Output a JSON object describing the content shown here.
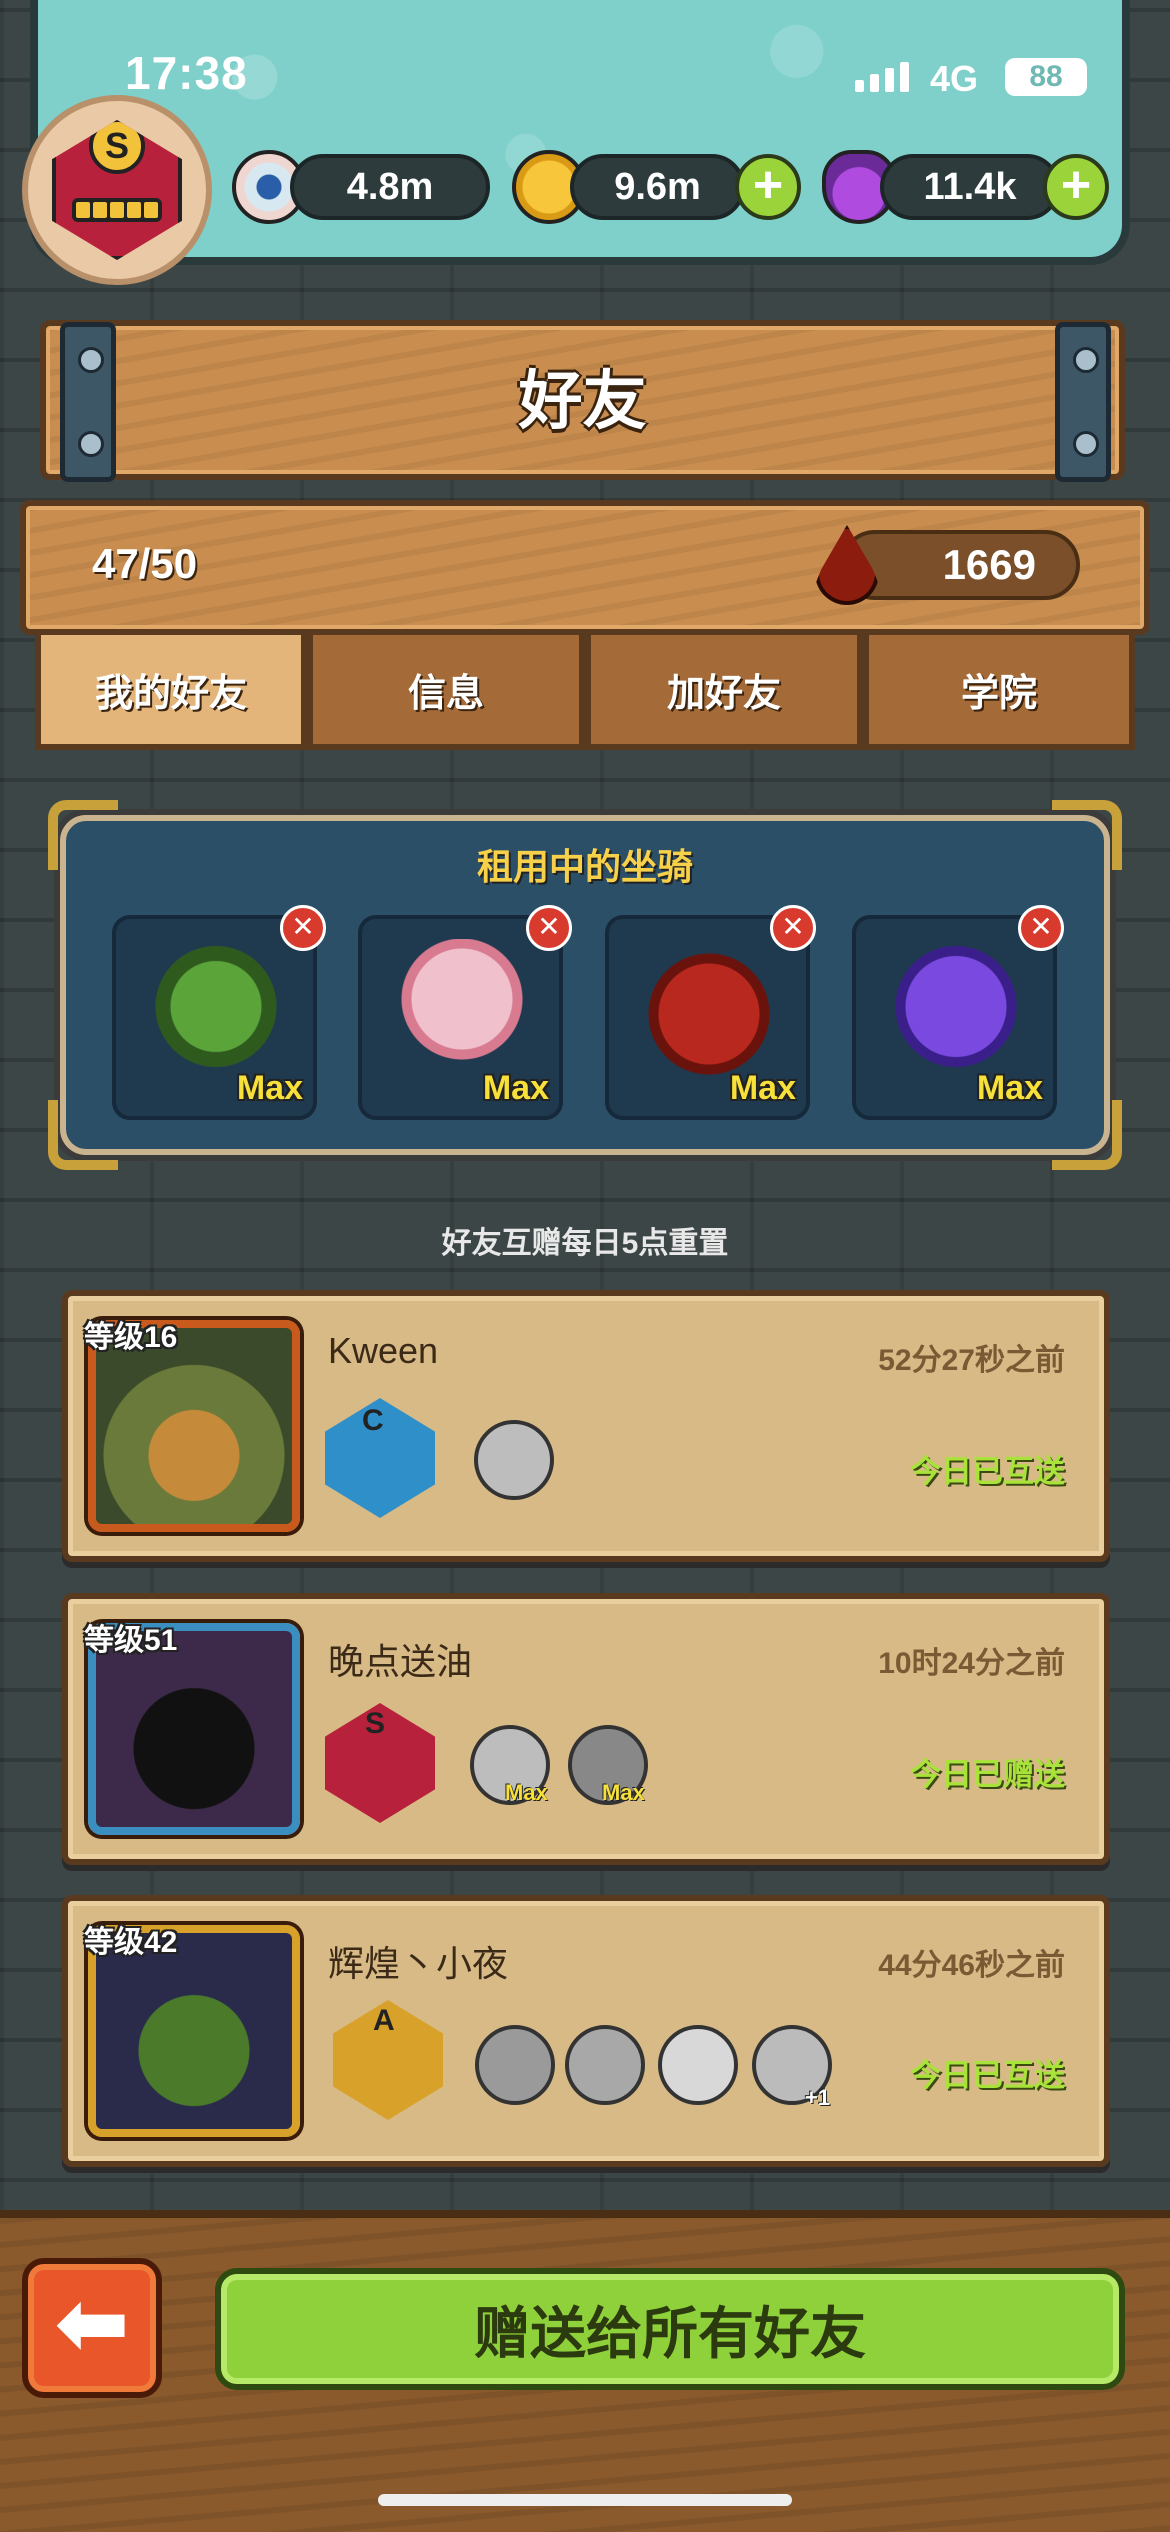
{
  "status_bar": {
    "time": "17:38",
    "network": "4G",
    "battery": "88"
  },
  "player": {
    "rank_letter": "S"
  },
  "resources": [
    {
      "icon": "eyeball-icon",
      "value": "4.8m",
      "has_plus": false
    },
    {
      "icon": "gold-coin-icon",
      "value": "9.6m",
      "has_plus": true
    },
    {
      "icon": "potion-icon",
      "value": "11.4k",
      "has_plus": true
    }
  ],
  "header": {
    "title": "好友"
  },
  "friends_info": {
    "count": "47/50",
    "drop_value": "1669"
  },
  "tabs": [
    {
      "label": "我的好友",
      "active": true
    },
    {
      "label": "信息",
      "active": false
    },
    {
      "label": "加好友",
      "active": false
    },
    {
      "label": "学院",
      "active": false
    }
  ],
  "rented_mounts": {
    "title": "租用中的坐骑",
    "items": [
      {
        "name": "green-ogre-mount",
        "badge": "Max",
        "color": "#3f7a2e"
      },
      {
        "name": "pink-balloon-mount",
        "badge": "Max",
        "color": "#e6a0b0"
      },
      {
        "name": "red-demon-mount",
        "badge": "Max",
        "color": "#a3241e"
      },
      {
        "name": "purple-rose-mount",
        "badge": "Max",
        "color": "#5a3aa8"
      }
    ]
  },
  "reset_note": "好友互赠每日5点重置",
  "friends": [
    {
      "level": "等级16",
      "name": "Kween",
      "time": "52分27秒之前",
      "status": "今日已互送",
      "rank": "C",
      "rank_color": "#2f8fc9",
      "avatar_color": "#8a6b2a",
      "frame_color": "#c85a1e",
      "mounts": [
        {
          "badge": ""
        }
      ]
    },
    {
      "level": "等级51",
      "name": "晚点送油",
      "time": "10时24分之前",
      "status": "今日已赠送",
      "rank": "S",
      "rank_color": "#b8213c",
      "avatar_color": "#3d2a4a",
      "frame_color": "#3a8fc0",
      "mounts": [
        {
          "badge": "Max"
        },
        {
          "badge": "Max"
        }
      ]
    },
    {
      "level": "等级42",
      "name": "辉煌丶小夜",
      "time": "44分46秒之前",
      "status": "今日已互送",
      "rank": "A",
      "rank_color": "#d8a12a",
      "avatar_color": "#4a6a2a",
      "frame_color": "#d8a12a",
      "mounts": [
        {
          "badge": ""
        },
        {
          "badge": ""
        },
        {
          "badge": ""
        },
        {
          "badge": "+1"
        }
      ]
    }
  ],
  "actions": {
    "back_icon": "back-arrow-icon",
    "gift_all_label": "赠送给所有好友"
  }
}
